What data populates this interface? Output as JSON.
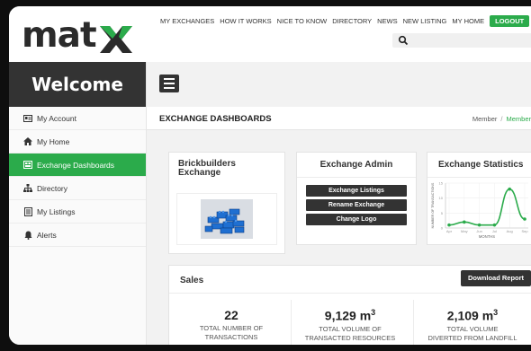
{
  "brand": {
    "name": "mat",
    "accent": "#2bab4b",
    "dark": "#333333"
  },
  "topnav": {
    "items": [
      "MY EXCHANGES",
      "HOW IT WORKS",
      "NICE TO KNOW",
      "DIRECTORY",
      "NEWS",
      "NEW LISTING",
      "MY HOME"
    ],
    "logout": "LOGOUT"
  },
  "search": {
    "icon": "search-icon"
  },
  "sidebar": {
    "welcome": "Welcome",
    "items": [
      {
        "label": "My Account",
        "icon": "id-card-icon"
      },
      {
        "label": "My Home",
        "icon": "home-icon"
      },
      {
        "label": "Exchange Dashboards",
        "icon": "dashboard-icon",
        "active": true
      },
      {
        "label": "Directory",
        "icon": "sitemap-icon"
      },
      {
        "label": "My Listings",
        "icon": "list-icon"
      },
      {
        "label": "Alerts",
        "icon": "bell-icon"
      }
    ]
  },
  "main": {
    "title": "EXCHANGE DASHBOARDS",
    "breadcrumb": {
      "first": "Member",
      "sep": "/",
      "current": "Member"
    }
  },
  "exchange": {
    "title_line1": "Brickbuilders",
    "title_line2": "Exchange"
  },
  "admin": {
    "title": "Exchange Admin",
    "buttons": [
      "Exchange Listings",
      "Rename Exchange",
      "Change Logo"
    ]
  },
  "stats_card": {
    "title": "Exchange Statistics"
  },
  "chart_data": {
    "type": "line",
    "title": "",
    "xlabel": "MONTHS",
    "ylabel": "NUMBER OF TRANSACTIONS",
    "categories": [
      "Apr",
      "May",
      "Jun",
      "Jul",
      "Aug",
      "Sep"
    ],
    "yticks": [
      0,
      5,
      10,
      15
    ],
    "ylim": [
      0,
      15
    ],
    "series": [
      {
        "values": [
          1,
          2,
          1,
          1,
          13,
          3
        ]
      }
    ],
    "color": "#2bab4b",
    "grid": true
  },
  "sales": {
    "title": "Sales",
    "download": "Download Report",
    "stats": [
      {
        "value": "22",
        "unit": "",
        "label1": "TOTAL NUMBER OF",
        "label2": "TRANSACTIONS"
      },
      {
        "value": "9,129 m",
        "unit": "3",
        "label1": "TOTAL VOLUME OF",
        "label2": "TRANSACTED RESOURCES"
      },
      {
        "value": "2,109 m",
        "unit": "3",
        "label1": "TOTAL VOLUME",
        "label2": "DIVERTED FROM LANDFILL"
      }
    ]
  }
}
